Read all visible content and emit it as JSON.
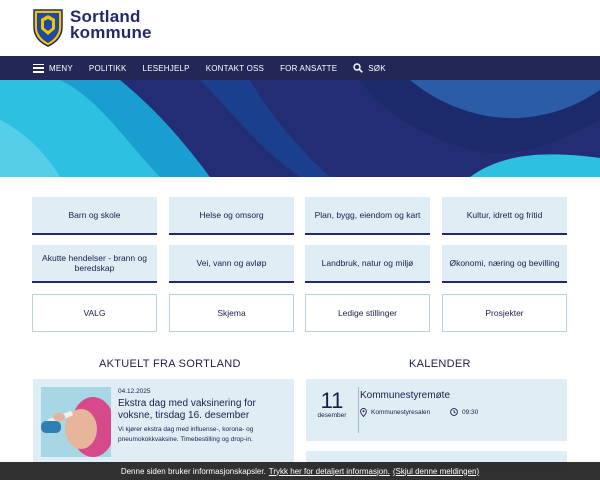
{
  "header": {
    "logo_line1": "Sortland",
    "logo_line2": "kommune"
  },
  "nav": {
    "menu": "MENY",
    "items": [
      "POLITIKK",
      "LESEHJELP",
      "KONTAKT OSS",
      "FOR ANSATTE"
    ],
    "search": "SØK"
  },
  "tiles": [
    "Barn og skole",
    "Helse og omsorg",
    "Plan, bygg, eiendom og kart",
    "Kultur, idrett og fritid",
    "Akutte hendelser - brann og beredskap",
    "Vei, vann og avløp",
    "Landbruk, natur og miljø",
    "Økonomi, næring og bevilling",
    "VALG",
    "Skjema",
    "Ledige stillinger",
    "Prosjekter"
  ],
  "news": {
    "heading": "AKTUELT FRA SORTLAND",
    "date": "04.12.2025",
    "title": "Ekstra dag med vaksinering for voksne, tirsdag 16. desember",
    "text": "Vi kjører ekstra dag med influense-, korona- og pneumokokkvaksine. Timebestilling og drop-in."
  },
  "calendar": {
    "heading": "KALENDER",
    "day": "11",
    "month": "desember",
    "title": "Kommunestyremøte",
    "location": "Kommunestyresalen",
    "time": "09:30"
  },
  "cookie": {
    "text": "Denne siden bruker informasjonskapsler.",
    "link1": "Trykk her for detaljert informasjon.",
    "link2": "(Skjul denne meldingen)"
  },
  "colors": {
    "navy": "#222755",
    "tile": "#dfedf5",
    "hero_light": "#2ec0e0",
    "hero_dark": "#1b2a6a"
  }
}
